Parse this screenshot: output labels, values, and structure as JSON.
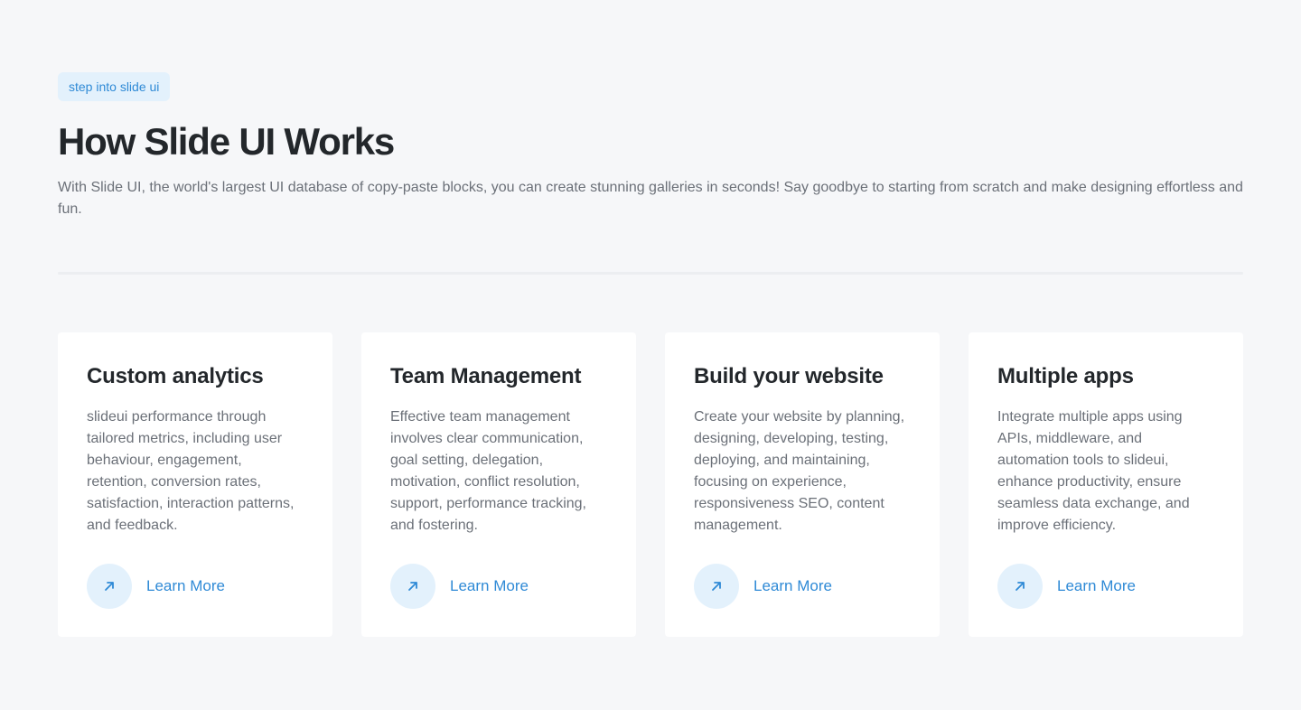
{
  "header": {
    "badge": "step into slide ui",
    "title": "How Slide UI Works",
    "description": "With Slide UI, the world's largest UI database of copy-paste blocks, you can create stunning galleries in seconds! Say goodbye to starting from scratch and make designing effortless and fun."
  },
  "cards": [
    {
      "title": "Custom analytics",
      "text": "slideui performance through tailored metrics, including user behaviour, engagement, retention, conversion rates, satisfaction, interaction patterns, and feedback.",
      "link_label": "Learn More",
      "icon": "arrow-up-right-icon"
    },
    {
      "title": "Team Management",
      "text": "Effective team management involves clear communication, goal setting, delegation, motivation, conflict resolution, support, performance tracking, and fostering.",
      "link_label": "Learn More",
      "icon": "arrow-up-right-icon"
    },
    {
      "title": "Build your website",
      "text": "Create your website by planning, designing, developing, testing, deploying, and maintaining, focusing on experience, responsiveness SEO, content management.",
      "link_label": "Learn More",
      "icon": "arrow-up-right-icon"
    },
    {
      "title": "Multiple apps",
      "text": "Integrate multiple apps using APIs, middleware, and automation tools to slideui, enhance productivity, ensure seamless data exchange, and improve efficiency.",
      "link_label": "Learn More",
      "icon": "arrow-up-right-icon"
    }
  ],
  "colors": {
    "accent": "#2f8ad6",
    "accent_bg": "#e3f1fc",
    "page_bg": "#f6f7f9",
    "card_bg": "#ffffff",
    "heading": "#23272b",
    "body_text": "#6b7078"
  }
}
